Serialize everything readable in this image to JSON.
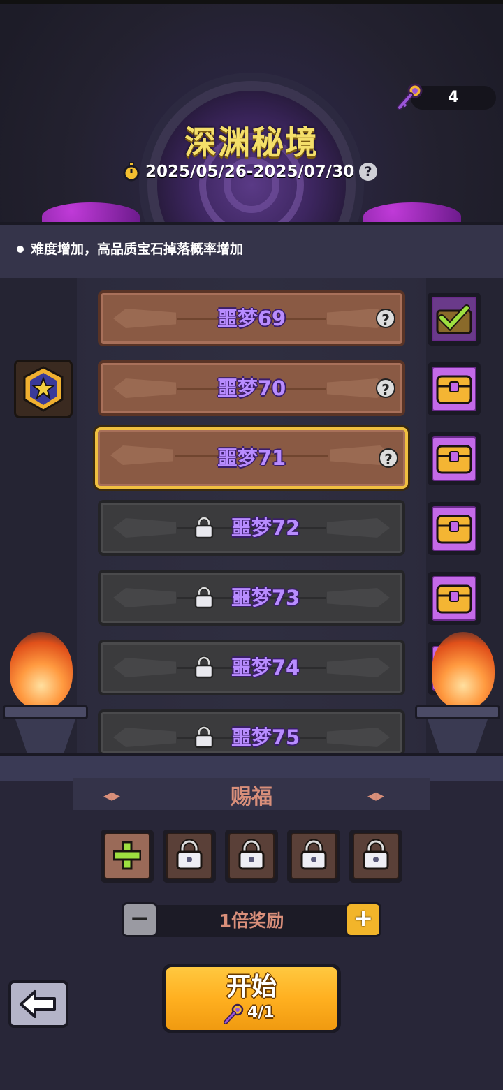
{
  "header": {
    "key_count": "4",
    "title": "深渊秘境",
    "date_range": "2025/05/26-2025/07/30",
    "help_icon": "?"
  },
  "info": {
    "description": "难度增加，高品质宝石掉落概率增加"
  },
  "levels": [
    {
      "name": "噩梦69",
      "state": "open",
      "reward": "claimed-chest"
    },
    {
      "name": "噩梦70",
      "state": "open",
      "reward": "chest"
    },
    {
      "name": "噩梦71",
      "state": "selected",
      "reward": "chest"
    },
    {
      "name": "噩梦72",
      "state": "locked",
      "reward": "chest"
    },
    {
      "name": "噩梦73",
      "state": "locked",
      "reward": "chest"
    },
    {
      "name": "噩梦74",
      "state": "locked",
      "reward": "chest"
    },
    {
      "name": "噩梦75",
      "state": "locked",
      "reward": "chest"
    }
  ],
  "blessing": {
    "label": "赐福",
    "slots": [
      "add",
      "locked",
      "locked",
      "locked",
      "locked"
    ]
  },
  "multiplier": {
    "label": "1倍奖励",
    "minus": "−",
    "plus": "+"
  },
  "start": {
    "label": "开始",
    "cost": "4/1"
  },
  "colors": {
    "title": "#f4df6a",
    "level_name": "#b88cff",
    "accent": "#f2b52a",
    "blessing": "#d98f7a"
  }
}
